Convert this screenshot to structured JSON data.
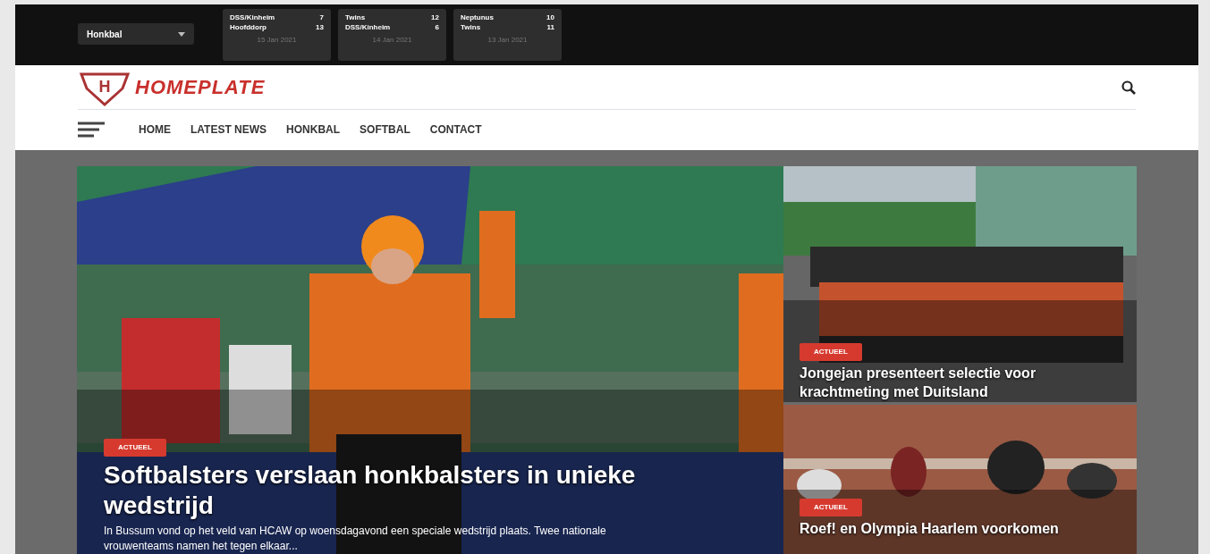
{
  "sport_select": {
    "value": "Honkbal"
  },
  "scores": [
    {
      "teams": [
        {
          "name": "DSS/Kinheim",
          "score": "7"
        },
        {
          "name": "Hoofddorp",
          "score": "13"
        }
      ],
      "date": "15 Jan 2021"
    },
    {
      "teams": [
        {
          "name": "Twins",
          "score": "12"
        },
        {
          "name": "DSS/Kinheim",
          "score": "6"
        }
      ],
      "date": "14 Jan 2021"
    },
    {
      "teams": [
        {
          "name": "Neptunus",
          "score": "10"
        },
        {
          "name": "Twins",
          "score": "11"
        }
      ],
      "date": "13 Jan 2021"
    }
  ],
  "logo": {
    "text": "HOMEPLATE",
    "letter": "H"
  },
  "nav": [
    "HOME",
    "LATEST NEWS",
    "HONKBAL",
    "SOFTBAL",
    "CONTACT"
  ],
  "featured": {
    "tag": "ACTUEEL",
    "title": "Softbalsters verslaan honkbalsters in unieke wedstrijd",
    "excerpt": "In Bussum vond op het veld van HCAW op woensdagavond een speciale wedstrijd plaats. Twee nationale vrouwenteams namen het tegen elkaar..."
  },
  "side_articles": [
    {
      "tag": "ACTUEEL",
      "title": "Jongejan presenteert selectie voor krachtmeting met Duitsland",
      "kind": "picture"
    },
    {
      "tag": "ACTUEEL",
      "title": "Roef! en Olympia Haarlem voorkomen",
      "kind": "picture"
    }
  ]
}
